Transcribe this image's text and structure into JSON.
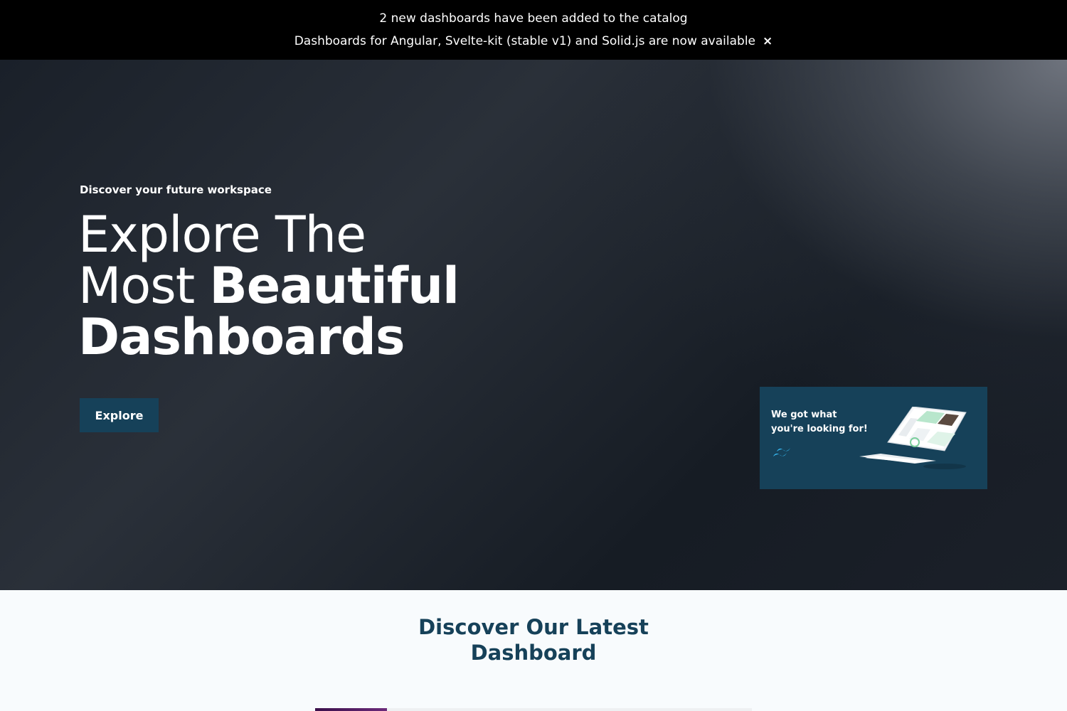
{
  "announcement": {
    "line1": "2 new dashboards have been added to the catalog",
    "line2": "Dashboards for Angular, Svelte-kit (stable v1) and Solid.js are now available",
    "close_label": "×"
  },
  "hero": {
    "eyebrow": "Discover your future workspace",
    "headline": {
      "line1": "Explore The",
      "line2_regular": "Most ",
      "line2_bold": "Beautiful",
      "line3": "Dashboards"
    },
    "cta_label": "Explore",
    "promo": {
      "text": "We got what you're looking for!",
      "icon": "tailwind-logo-icon",
      "image": "laptop-dashboard-illustration"
    }
  },
  "latest": {
    "title_line1": "Discover Our Latest",
    "title_line2": "Dashboard"
  },
  "colors": {
    "announcement_bg": "#000000",
    "hero_bg": "#1a2029",
    "brand": "#164159",
    "page_bg": "#f8fbfd",
    "tailwind_teal": "#38bdf8"
  }
}
